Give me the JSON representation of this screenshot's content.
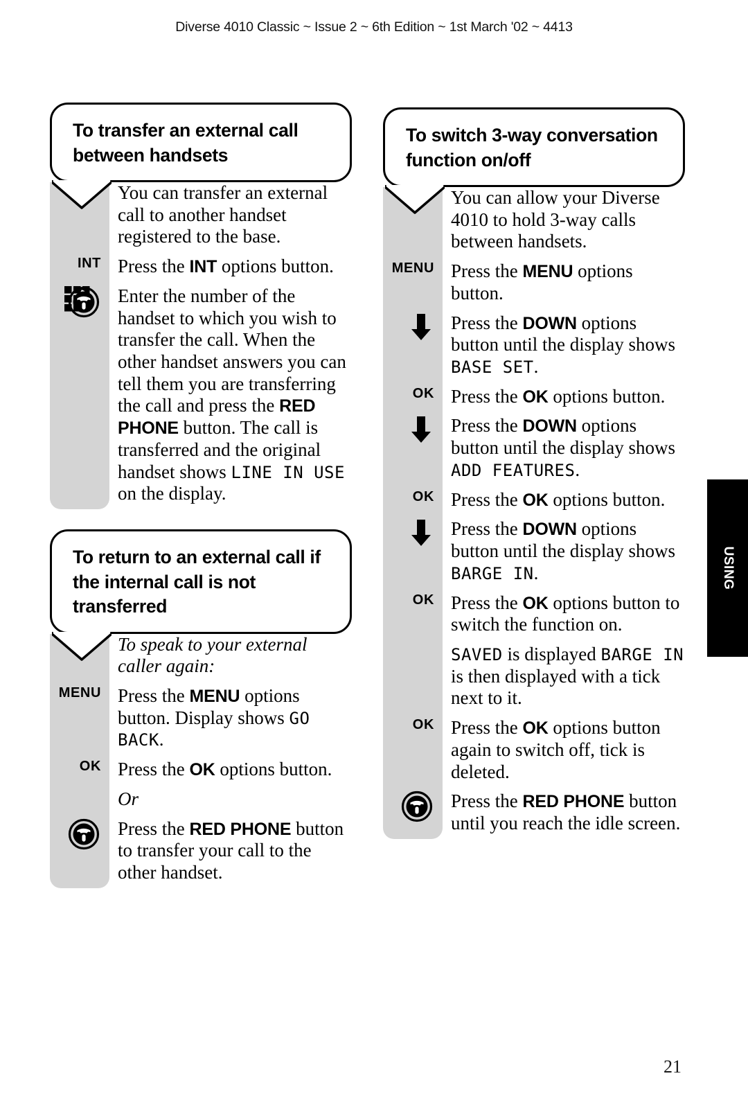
{
  "header": {
    "running_head": "Diverse 4010 Classic ~ Issue 2 ~ 6th Edition ~ 1st March '02 ~ 4413"
  },
  "thumb_tab": {
    "label": "USING",
    "background": "#000000",
    "text_color": "#ffffff"
  },
  "page_number": "21",
  "colors": {
    "gutter_grey": "#d4d4d4",
    "ink": "#000000",
    "paper": "#ffffff"
  },
  "sections": [
    {
      "id": "transfer-external-call",
      "title": "To transfer an external call between handsets",
      "steps": [
        {
          "key": "",
          "icon": "none",
          "parts": [
            {
              "type": "plain",
              "text": "You can transfer an external call to another handset registered to the base."
            }
          ]
        },
        {
          "key": "INT",
          "icon": "none",
          "parts": [
            {
              "type": "plain",
              "text": "Press the "
            },
            {
              "type": "bold",
              "text": "INT"
            },
            {
              "type": "plain",
              "text": " options button."
            }
          ]
        },
        {
          "key": "",
          "icon": "keypad-icon",
          "parts": [
            {
              "type": "plain",
              "text": "Enter the number of the handset to which you wish to transfer the call. When the other handset answers you can tell them you are transferring the call and press the "
            },
            {
              "type": "bold",
              "text": "RED PHONE"
            },
            {
              "type": "plain",
              "text": " button. The call is transferred and the original handset shows "
            },
            {
              "type": "lcd",
              "text": "LINE IN USE"
            },
            {
              "type": "plain",
              "text": " on the display."
            }
          ],
          "inline_icon": "red-phone-icon"
        }
      ]
    },
    {
      "id": "return-to-external-call",
      "title": "To return to an external call if the internal call is not transferred",
      "steps": [
        {
          "key": "",
          "icon": "none",
          "parts": [
            {
              "type": "italic",
              "text": "To speak to your external caller again:"
            }
          ]
        },
        {
          "key": "MENU",
          "icon": "none",
          "parts": [
            {
              "type": "plain",
              "text": "Press the "
            },
            {
              "type": "bold",
              "text": "MENU"
            },
            {
              "type": "plain",
              "text": " options button. Display shows "
            },
            {
              "type": "lcd",
              "text": "GO BACK"
            },
            {
              "type": "plain",
              "text": "."
            }
          ]
        },
        {
          "key": "OK",
          "icon": "none",
          "parts": [
            {
              "type": "plain",
              "text": "Press the "
            },
            {
              "type": "bold",
              "text": "OK"
            },
            {
              "type": "plain",
              "text": " options button."
            }
          ]
        },
        {
          "key": "",
          "icon": "none",
          "parts": [
            {
              "type": "italic",
              "text": "Or"
            }
          ]
        },
        {
          "key": "",
          "icon": "red-phone-icon",
          "parts": [
            {
              "type": "plain",
              "text": "Press the "
            },
            {
              "type": "bold",
              "text": "RED PHONE"
            },
            {
              "type": "plain",
              "text": " button to transfer your call to the other handset."
            }
          ]
        }
      ]
    },
    {
      "id": "switch-3-way-conversation",
      "title": "To switch 3-way conversation function on/off",
      "steps": [
        {
          "key": "",
          "icon": "none",
          "parts": [
            {
              "type": "plain",
              "text": "You can allow your Diverse 4010 to hold 3-way calls between handsets."
            }
          ]
        },
        {
          "key": "MENU",
          "icon": "none",
          "parts": [
            {
              "type": "plain",
              "text": "Press the "
            },
            {
              "type": "bold",
              "text": "MENU"
            },
            {
              "type": "plain",
              "text": " options button."
            }
          ]
        },
        {
          "key": "",
          "icon": "down-arrow-icon",
          "parts": [
            {
              "type": "plain",
              "text": "Press the "
            },
            {
              "type": "bold",
              "text": "DOWN"
            },
            {
              "type": "plain",
              "text": " options button until the display shows "
            },
            {
              "type": "lcd",
              "text": "BASE SET"
            },
            {
              "type": "plain",
              "text": "."
            }
          ]
        },
        {
          "key": "OK",
          "icon": "none",
          "parts": [
            {
              "type": "plain",
              "text": "Press the "
            },
            {
              "type": "bold",
              "text": "OK"
            },
            {
              "type": "plain",
              "text": " options button."
            }
          ]
        },
        {
          "key": "",
          "icon": "down-arrow-icon",
          "parts": [
            {
              "type": "plain",
              "text": "Press the "
            },
            {
              "type": "bold",
              "text": "DOWN"
            },
            {
              "type": "plain",
              "text": " options button until the display shows "
            },
            {
              "type": "lcd",
              "text": "ADD FEATURES"
            },
            {
              "type": "plain",
              "text": "."
            }
          ]
        },
        {
          "key": "OK",
          "icon": "none",
          "parts": [
            {
              "type": "plain",
              "text": "Press the "
            },
            {
              "type": "bold",
              "text": "OK"
            },
            {
              "type": "plain",
              "text": " options button."
            }
          ]
        },
        {
          "key": "",
          "icon": "down-arrow-icon",
          "parts": [
            {
              "type": "plain",
              "text": "Press the "
            },
            {
              "type": "bold",
              "text": "DOWN"
            },
            {
              "type": "plain",
              "text": " options button until the display shows "
            },
            {
              "type": "lcd",
              "text": "BARGE IN"
            },
            {
              "type": "plain",
              "text": "."
            }
          ]
        },
        {
          "key": "OK",
          "icon": "none",
          "parts": [
            {
              "type": "plain",
              "text": "Press the "
            },
            {
              "type": "bold",
              "text": "OK"
            },
            {
              "type": "plain",
              "text": " options button to switch the function on."
            }
          ]
        },
        {
          "key": "",
          "icon": "none",
          "parts": [
            {
              "type": "lcd",
              "text": "SAVED"
            },
            {
              "type": "plain",
              "text": " is displayed "
            },
            {
              "type": "lcd",
              "text": "BARGE IN"
            },
            {
              "type": "plain",
              "text": " is then displayed with a tick next to it."
            }
          ]
        },
        {
          "key": "OK",
          "icon": "none",
          "parts": [
            {
              "type": "plain",
              "text": "Press the "
            },
            {
              "type": "bold",
              "text": "OK"
            },
            {
              "type": "plain",
              "text": " options button again to switch off, tick is deleted."
            }
          ]
        },
        {
          "key": "",
          "icon": "red-phone-icon",
          "parts": [
            {
              "type": "plain",
              "text": "Press the "
            },
            {
              "type": "bold",
              "text": "RED PHONE"
            },
            {
              "type": "plain",
              "text": " button until you reach the idle screen."
            }
          ]
        }
      ]
    }
  ]
}
